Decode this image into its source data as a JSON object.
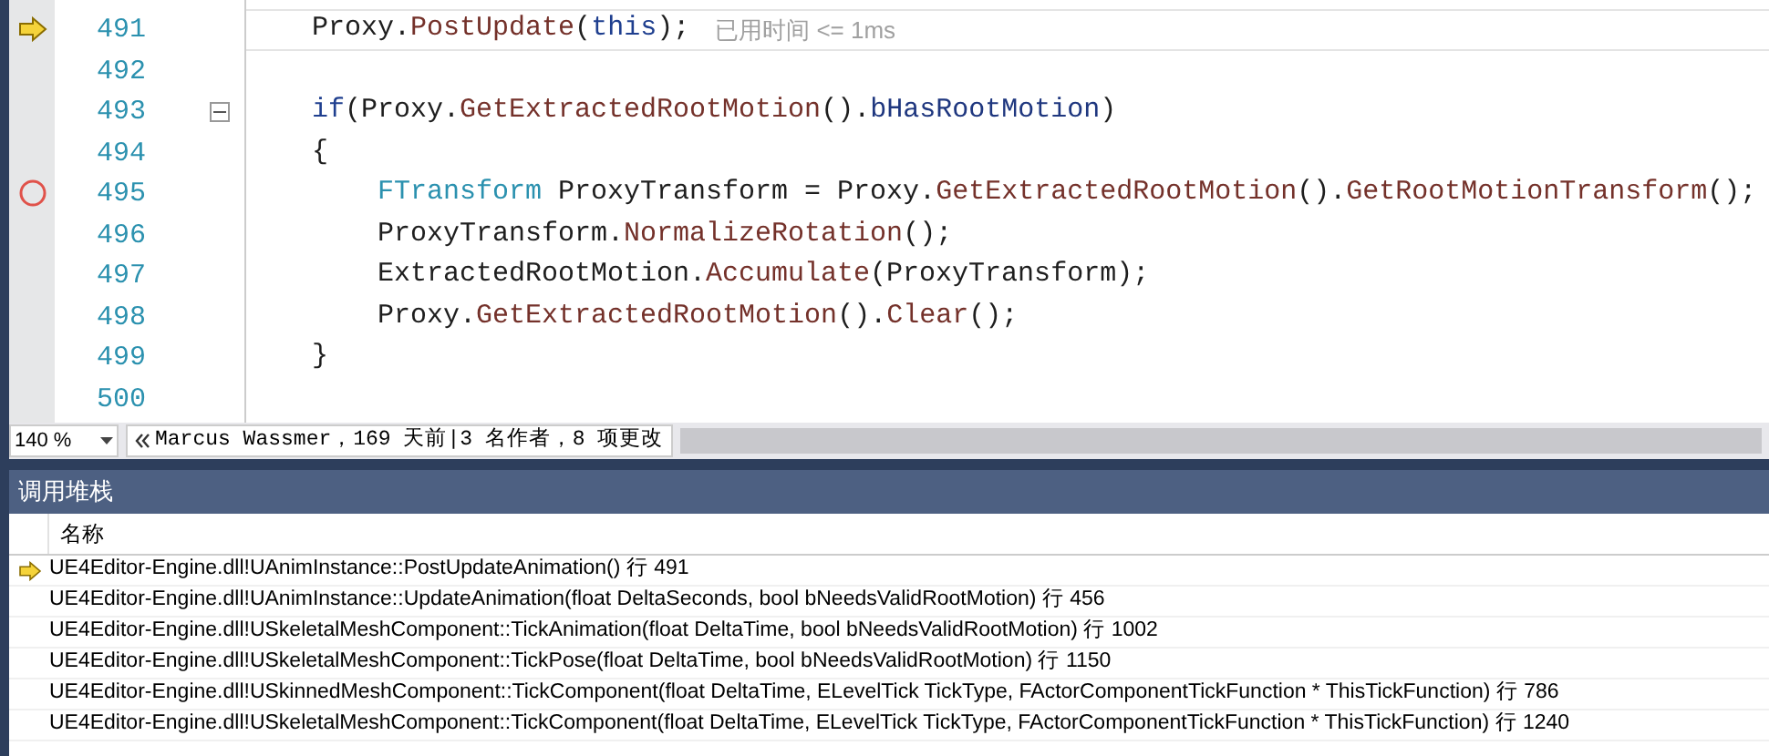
{
  "editor": {
    "lines": [
      {
        "number": "491",
        "current": true,
        "breakpoint": false,
        "tokens": [
          {
            "text": "Proxy",
            "kind": "plain"
          },
          {
            "text": ".",
            "kind": "plain"
          },
          {
            "text": "PostUpdate",
            "kind": "func"
          },
          {
            "text": "(",
            "kind": "plain"
          },
          {
            "text": "this",
            "kind": "keyword"
          },
          {
            "text": ");",
            "kind": "plain"
          }
        ],
        "hint": "已用时间 <= 1ms",
        "collapsible": false
      },
      {
        "number": "492",
        "current": false,
        "breakpoint": false,
        "collapsible": false
      },
      {
        "number": "493",
        "current": false,
        "breakpoint": false,
        "tokens": [
          {
            "text": "if",
            "kind": "keyword"
          },
          {
            "text": "(Proxy.",
            "kind": "plain"
          },
          {
            "text": "GetExtractedRootMotion",
            "kind": "func"
          },
          {
            "text": "().",
            "kind": "plain"
          },
          {
            "text": "bHasRootMotion",
            "kind": "member"
          },
          {
            "text": ")",
            "kind": "plain"
          }
        ],
        "collapsible": true
      },
      {
        "number": "494",
        "current": false,
        "breakpoint": false,
        "tokens": [
          {
            "text": "{",
            "kind": "plain"
          }
        ],
        "collapsible": false,
        "children": [
          {
            "number": "495",
            "current": false,
            "breakpoint": true,
            "tokens": [
              {
                "text": "FTransform",
                "kind": "type"
              },
              {
                "text": " ProxyTransform = Proxy.",
                "kind": "plain"
              },
              {
                "text": "GetExtractedRootMotion",
                "kind": "func"
              },
              {
                "text": "().",
                "kind": "plain"
              },
              {
                "text": "GetRootMotionTransform",
                "kind": "func"
              },
              {
                "text": "();",
                "kind": "plain"
              }
            ],
            "collapsible": false
          },
          {
            "number": "496",
            "current": false,
            "breakpoint": false,
            "tokens": [
              {
                "text": "ProxyTransform.",
                "kind": "plain"
              },
              {
                "text": "NormalizeRotation",
                "kind": "func"
              },
              {
                "text": "();",
                "kind": "plain"
              }
            ],
            "collapsible": false
          },
          {
            "number": "497",
            "current": false,
            "breakpoint": false,
            "tokens": [
              {
                "text": "ExtractedRootMotion.",
                "kind": "plain"
              },
              {
                "text": "Accumulate",
                "kind": "func"
              },
              {
                "text": "(ProxyTransform);",
                "kind": "plain"
              }
            ],
            "collapsible": false
          },
          {
            "number": "498",
            "current": false,
            "breakpoint": false,
            "tokens": [
              {
                "text": "Proxy.",
                "kind": "plain"
              },
              {
                "text": "GetExtractedRootMotion",
                "kind": "func"
              },
              {
                "text": "().",
                "kind": "plain"
              },
              {
                "text": "Clear",
                "kind": "func"
              },
              {
                "text": "();",
                "kind": "plain"
              }
            ],
            "collapsible": false
          }
        ]
      },
      {
        "number": "499",
        "current": false,
        "breakpoint": false,
        "tokens": [
          {
            "text": "}",
            "kind": "plain"
          }
        ],
        "collapsible": false
      },
      {
        "number": "500",
        "current": false,
        "breakpoint": false,
        "collapsible": false
      }
    ]
  },
  "status_bar": {
    "zoom": "140 %",
    "blame": "Marcus Wassmer，169 天前|3 名作者，8 项更改"
  },
  "call_stack": {
    "title": "调用堆栈",
    "columns": [
      "名称"
    ],
    "rows": [
      {
        "current": true,
        "name": "UE4Editor-Engine.dll!UAnimInstance::PostUpdateAnimation() 行 491"
      },
      {
        "current": false,
        "name": "UE4Editor-Engine.dll!UAnimInstance::UpdateAnimation(float DeltaSeconds, bool bNeedsValidRootMotion) 行 456"
      },
      {
        "current": false,
        "name": "UE4Editor-Engine.dll!USkeletalMeshComponent::TickAnimation(float DeltaTime, bool bNeedsValidRootMotion) 行 1002"
      },
      {
        "current": false,
        "name": "UE4Editor-Engine.dll!USkeletalMeshComponent::TickPose(float DeltaTime, bool bNeedsValidRootMotion) 行 1150"
      },
      {
        "current": false,
        "name": "UE4Editor-Engine.dll!USkinnedMeshComponent::TickComponent(float DeltaTime, ELevelTick TickType, FActorComponentTickFunction * ThisTickFunction) 行 786"
      },
      {
        "current": false,
        "name": "UE4Editor-Engine.dll!USkeletalMeshComponent::TickComponent(float DeltaTime, ELevelTick TickType, FActorComponentTickFunction * ThisTickFunction) 行 1240"
      }
    ]
  }
}
